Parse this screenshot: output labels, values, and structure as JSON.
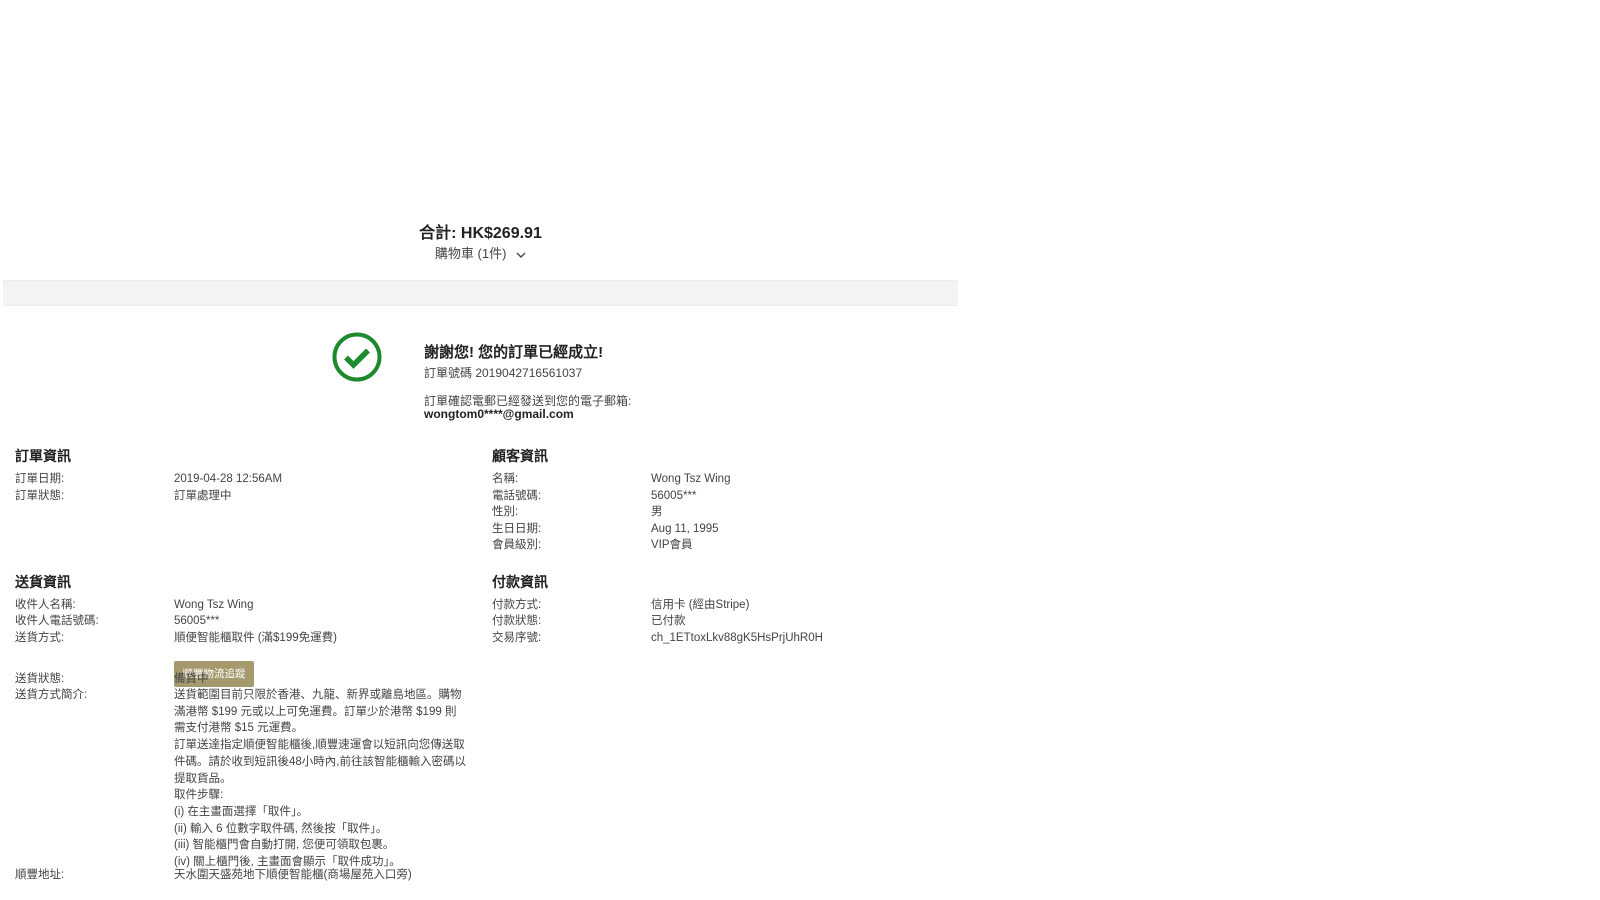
{
  "summary": {
    "total": "合計: HK$269.91",
    "cart_label": "購物車 (1件)"
  },
  "confirmation": {
    "thanks": "謝謝您! 您的訂單已經成立!",
    "order_number": "訂單號碼 2019042716561037",
    "email_note": "訂單確認電郵已經發送到您的電子郵箱:",
    "email": "wongtom0****@gmail.com",
    "icon": "check-circle-icon",
    "icon_color": "#1e8a2e"
  },
  "order_info": {
    "title": "訂單資訊",
    "rows": [
      {
        "label": "訂單日期:",
        "value": "2019-04-28 12:56AM"
      },
      {
        "label": "訂單狀態:",
        "value": "訂單處理中"
      }
    ]
  },
  "customer_info": {
    "title": "顧客資訊",
    "rows": [
      {
        "label": "名稱:",
        "value": "Wong Tsz Wing"
      },
      {
        "label": "電話號碼:",
        "value": "56005***"
      },
      {
        "label": "性別:",
        "value": "男"
      },
      {
        "label": "生日日期:",
        "value": "Aug 11, 1995"
      },
      {
        "label": "會員級別:",
        "value": "VIP會員"
      }
    ]
  },
  "delivery_info": {
    "title": "送貨資訊",
    "recipient_label": "收件人名稱:",
    "recipient_value": "Wong Tsz Wing",
    "phone_label": "收件人電話號碼:",
    "phone_value": "56005***",
    "method_label": "送貨方式:",
    "method_value": "順便智能櫃取件 (滿$199免運費)",
    "track_button": "順豐物流追蹤",
    "track_button_color": "#a59a6e",
    "status_label": "送貨狀態:",
    "status_value": "備貨中",
    "desc_label": "送貨方式簡介:",
    "desc_lines": [
      "送貨範圍目前只限於香港、九龍、新界或離島地區。購物滿港幣 $199 元或以上可免運費。訂單少於港幣 $199 則需支付港幣 $15 元運費。",
      "訂單送達指定順便智能櫃後,順豐速運會以短訊向您傳送取件碼。請於收到短訊後48小時內,前往該智能櫃輸入密碼以提取貨品。",
      "取件步驟:",
      "(i) 在主畫面選擇「取件」。",
      "(ii) 輸入 6 位數字取件碼, 然後按「取件」。",
      "(iii) 智能櫃門會自動打開, 您便可領取包裹。",
      "(iv) 關上櫃門後, 主畫面會顯示「取件成功」。"
    ],
    "address_label": "順豐地址:",
    "address_value": "天水圍天盛苑地下順便智能櫃(商場屋苑入口旁)"
  },
  "payment_info": {
    "title": "付款資訊",
    "rows": [
      {
        "label": "付款方式:",
        "value": "信用卡 (經由Stripe)"
      },
      {
        "label": "付款狀態:",
        "value": "已付款"
      },
      {
        "label": "交易序號:",
        "value": "ch_1ETtoxLkv88gK5HsPrjUhR0H"
      }
    ]
  }
}
